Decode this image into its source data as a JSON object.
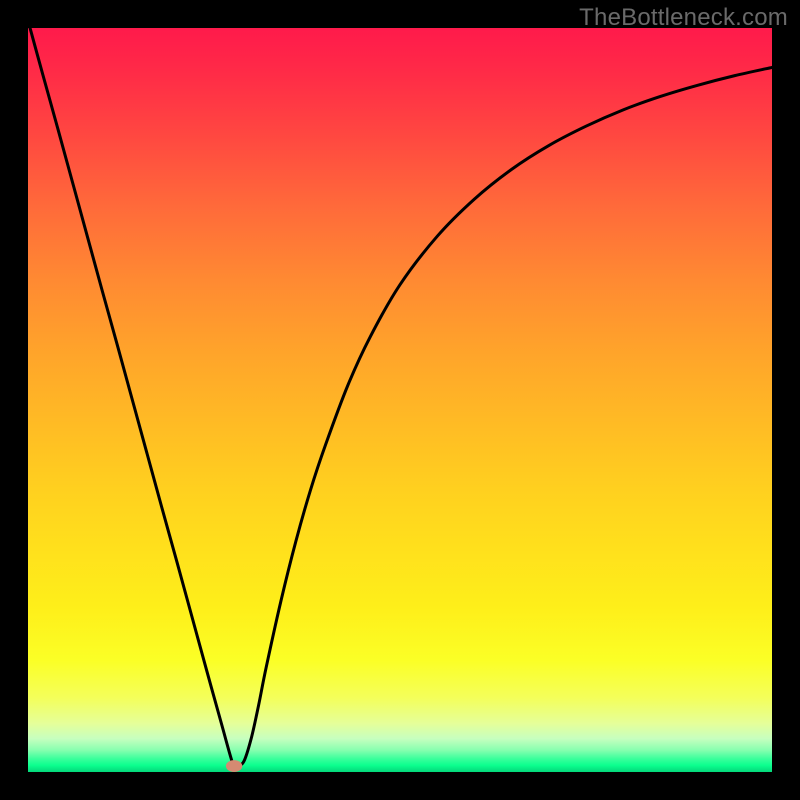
{
  "watermark": "TheBottleneck.com",
  "colors": {
    "frame": "#000000",
    "curve": "#000000",
    "marker": "#d58a72"
  },
  "chart_data": {
    "type": "line",
    "title": "",
    "xlabel": "",
    "ylabel": "",
    "xlim": [
      0,
      100
    ],
    "ylim": [
      0,
      100
    ],
    "grid": false,
    "series": [
      {
        "name": "bottleneck-curve",
        "x": [
          0,
          2,
          4,
          6,
          8,
          10,
          12,
          14,
          16,
          18,
          20,
          22,
          24,
          26,
          27.5,
          28,
          29,
          30,
          31,
          32,
          34,
          36,
          38,
          40,
          43,
          46,
          50,
          55,
          60,
          65,
          70,
          75,
          80,
          85,
          90,
          95,
          100
        ],
        "y": [
          101,
          93.7,
          86.5,
          79.2,
          71.9,
          64.6,
          57.4,
          50.1,
          42.8,
          35.5,
          28.3,
          21.0,
          13.7,
          6.5,
          1.2,
          0.8,
          1.4,
          4.5,
          9.0,
          14.0,
          23.0,
          31.0,
          38.0,
          44.0,
          52.0,
          58.5,
          65.5,
          72.0,
          77.0,
          81.0,
          84.2,
          86.8,
          89.0,
          90.8,
          92.3,
          93.6,
          94.7
        ]
      }
    ],
    "marker": {
      "cx": 27.7,
      "cy": 0.8,
      "rx": 1.1,
      "ry": 0.8
    },
    "gradient_stops": [
      {
        "pos": 0,
        "color": "#ff1a4b"
      },
      {
        "pos": 0.5,
        "color": "#ffbd24"
      },
      {
        "pos": 0.85,
        "color": "#fbff26"
      },
      {
        "pos": 1.0,
        "color": "#04d87a"
      }
    ]
  }
}
